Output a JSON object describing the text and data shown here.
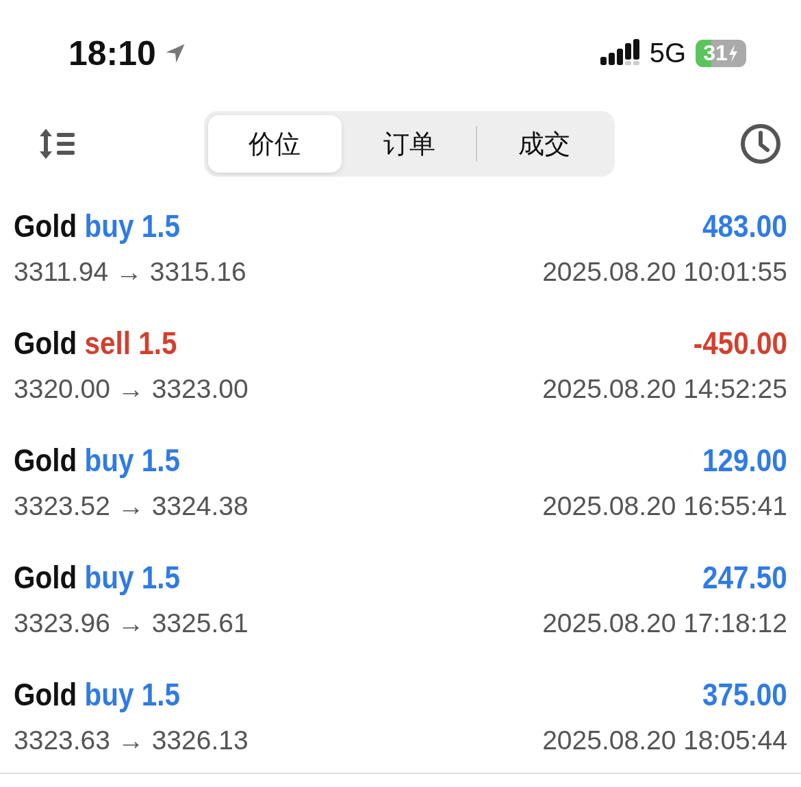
{
  "status_bar": {
    "time": "18:10",
    "network": "5G",
    "battery": "31"
  },
  "tabs": [
    {
      "label": "价位",
      "selected": true
    },
    {
      "label": "订单",
      "selected": false
    },
    {
      "label": "成交",
      "selected": false
    }
  ],
  "trades": [
    {
      "symbol": "Gold",
      "kind": "buy",
      "side": "buy",
      "volume": "1.5",
      "profit": "483.00",
      "prices": "3311.94 → 3315.16",
      "time": "2025.08.20 10:01:55"
    },
    {
      "symbol": "Gold",
      "kind": "sell",
      "side": "sell",
      "volume": "1.5",
      "profit": "-450.00",
      "prices": "3320.00 → 3323.00",
      "time": "2025.08.20 14:52:25"
    },
    {
      "symbol": "Gold",
      "kind": "buy",
      "side": "buy",
      "volume": "1.5",
      "profit": "129.00",
      "prices": "3323.52 → 3324.38",
      "time": "2025.08.20 16:55:41"
    },
    {
      "symbol": "Gold",
      "kind": "buy",
      "side": "buy",
      "volume": "1.5",
      "profit": "247.50",
      "prices": "3323.96 → 3325.61",
      "time": "2025.08.20 17:18:12"
    },
    {
      "symbol": "Gold",
      "kind": "buy",
      "side": "buy",
      "volume": "1.5",
      "profit": "375.00",
      "prices": "3323.63 → 3326.13",
      "time": "2025.08.20 18:05:44"
    }
  ]
}
